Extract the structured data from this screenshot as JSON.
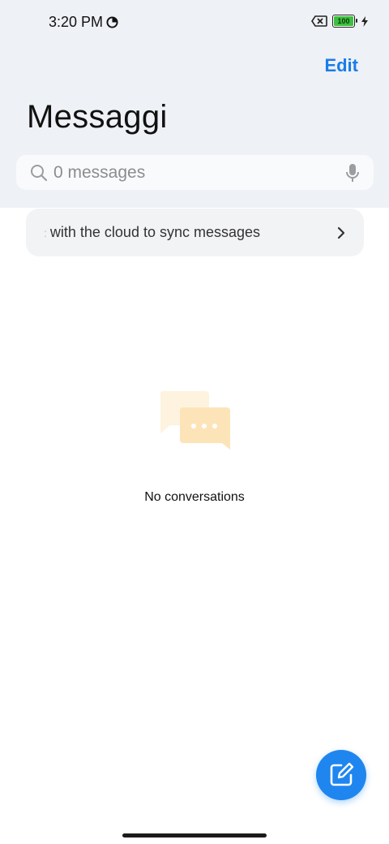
{
  "status_bar": {
    "time": "3:20 PM",
    "battery_level": "100",
    "icons": [
      "data-saver-icon",
      "sim-error-icon",
      "battery-icon",
      "charging-bolt-icon"
    ]
  },
  "header": {
    "edit_label": "Edit",
    "title": "Messaggi"
  },
  "search": {
    "placeholder": "0 messages",
    "icons": [
      "search-icon",
      "mic-icon"
    ]
  },
  "banner": {
    "text": "with the cloud to sync messages",
    "icon": "chevron-right-icon"
  },
  "empty_state": {
    "text": "No conversations",
    "icon": "chat-bubbles-icon"
  },
  "fab": {
    "icon": "compose-icon"
  },
  "colors": {
    "accent": "#1a7de8",
    "header_bg": "#eef1f5",
    "battery_fill": "#3fbf3f"
  }
}
